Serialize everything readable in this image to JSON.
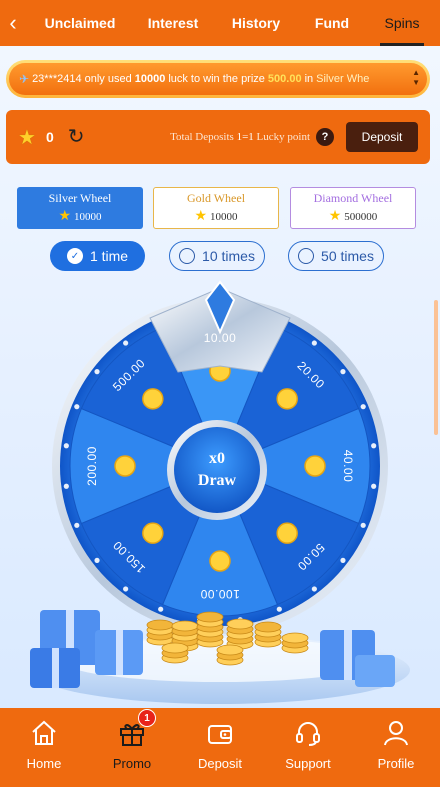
{
  "header": {
    "back_icon": "chevron-left-icon",
    "tabs": [
      {
        "label": "Unclaimed",
        "active": false
      },
      {
        "label": "Interest",
        "active": false
      },
      {
        "label": "History",
        "active": false
      },
      {
        "label": "Fund",
        "active": false
      },
      {
        "label": "Spins",
        "active": true
      }
    ]
  },
  "marquee": {
    "user": "23***2414",
    "text_before": "only used",
    "amount": "10000",
    "text_middle": "luck to win the prize",
    "prize": "500.00",
    "text_after": "in",
    "wheel": "Silver Whe"
  },
  "points_bar": {
    "points": "0",
    "rule_prefix": "Total Deposits",
    "rule_ratio": "1=1",
    "rule_suffix": "Lucky point",
    "help": "?",
    "deposit_label": "Deposit"
  },
  "wheels": [
    {
      "name": "Silver Wheel",
      "cost": "10000",
      "selected": true
    },
    {
      "name": "Gold Wheel",
      "cost": "10000",
      "selected": false
    },
    {
      "name": "Diamond Wheel",
      "cost": "500000",
      "selected": false
    }
  ],
  "times": [
    {
      "label": "1 time",
      "selected": true
    },
    {
      "label": "10 times",
      "selected": false
    },
    {
      "label": "50 times",
      "selected": false
    }
  ],
  "wheel": {
    "segments": [
      "10.00",
      "20.00",
      "40.00",
      "50.00",
      "100.00",
      "150.00",
      "200.00",
      "500.00"
    ],
    "multiplier": "x0",
    "draw_label": "Draw"
  },
  "bottom_nav": [
    {
      "label": "Home",
      "icon": "home-icon",
      "active": false
    },
    {
      "label": "Promo",
      "icon": "gift-icon",
      "active": true,
      "badge": "1"
    },
    {
      "label": "Deposit",
      "icon": "wallet-icon",
      "active": false
    },
    {
      "label": "Support",
      "icon": "headset-icon",
      "active": false
    },
    {
      "label": "Profile",
      "icon": "user-icon",
      "active": false
    }
  ],
  "colors": {
    "brand_orange": "#ef6a0f",
    "wheel_blue": "#1f6fe0",
    "badge_red": "#e8231a"
  }
}
